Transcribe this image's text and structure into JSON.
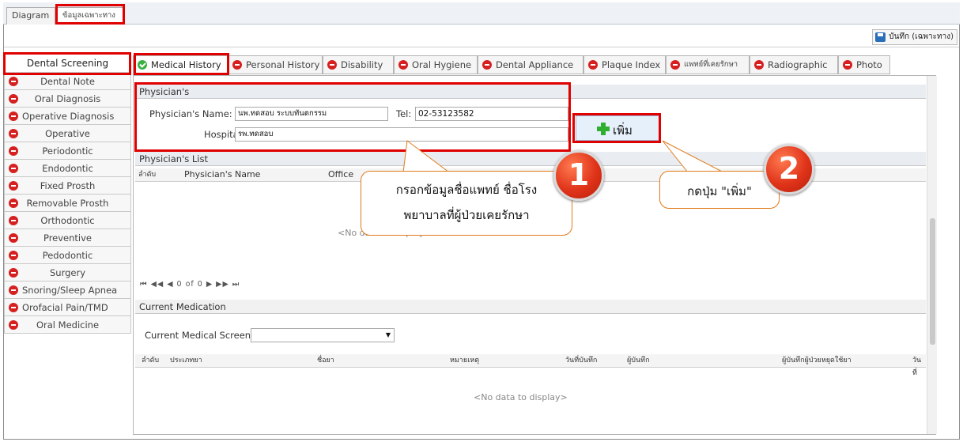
{
  "top_tabs": [
    "Diagram",
    "ข้อมูลเฉพาะทาง"
  ],
  "save_label": "บันทึก (เฉพาะทาง)",
  "sidebar": {
    "header": "Dental Screening",
    "items": [
      "Dental Note",
      "Oral Diagnosis",
      "Operative Diagnosis",
      "Operative",
      "Periodontic",
      "Endodontic",
      "Fixed Prosth",
      "Removable Prosth",
      "Orthodontic",
      "Preventive",
      "Pedodontic",
      "Surgery",
      "Snoring/Sleep Apnea",
      "Orofacial Pain/TMD",
      "Oral Medicine"
    ]
  },
  "tabs": [
    "Medical History",
    "Personal History",
    "Disability",
    "Oral Hygiene",
    "Dental Appliance",
    "Plaque Index",
    "แพทย์ที่เคยรักษา",
    "Radiographic",
    "Photo"
  ],
  "physician": {
    "header": "Physician's",
    "name_label": "Physician's Name:",
    "name_value": "นพ.ทดสอบ ระบบทันตกรรม",
    "tel_label": "Tel:",
    "tel_value": "02-53123582",
    "hospital_label": "Hospital:",
    "hospital_value": "รพ.ทดสอบ"
  },
  "add_button": "เพิ่ม",
  "physician_list": {
    "header": "Physician's List",
    "columns": [
      "ลำดับ",
      "Physician's Name",
      "Office"
    ],
    "nodata": "<No data to display>",
    "nav": "0 of 0"
  },
  "current_medication": {
    "header": "Current Medication",
    "screen_label": "Current Medical Screen",
    "columns": [
      "ลำดับ",
      "ประเภทยา",
      "ชื่อยา",
      "หมายเหตุ",
      "วันที่บันทึก",
      "ผู้บันทึก",
      "ผู้บันทึกผู้ป่วยหยุดใช้ยา",
      "วันที่"
    ],
    "nodata": "<No data to display>"
  },
  "callout1": {
    "line1": "กรอกข้อมูลชื่อแพทย์ ชื่อโรง",
    "line2": "พยาบาลที่ผู้ป่วยเคยรักษา"
  },
  "callout2": "กดปุ่ม \"เพิ่ม\"",
  "badge1": "1",
  "badge2": "2",
  "colors": {
    "accent_red": "#e00000",
    "remove_red": "#d62020",
    "ok_green": "#3cb043",
    "callout_orange": "#e07a1a"
  }
}
